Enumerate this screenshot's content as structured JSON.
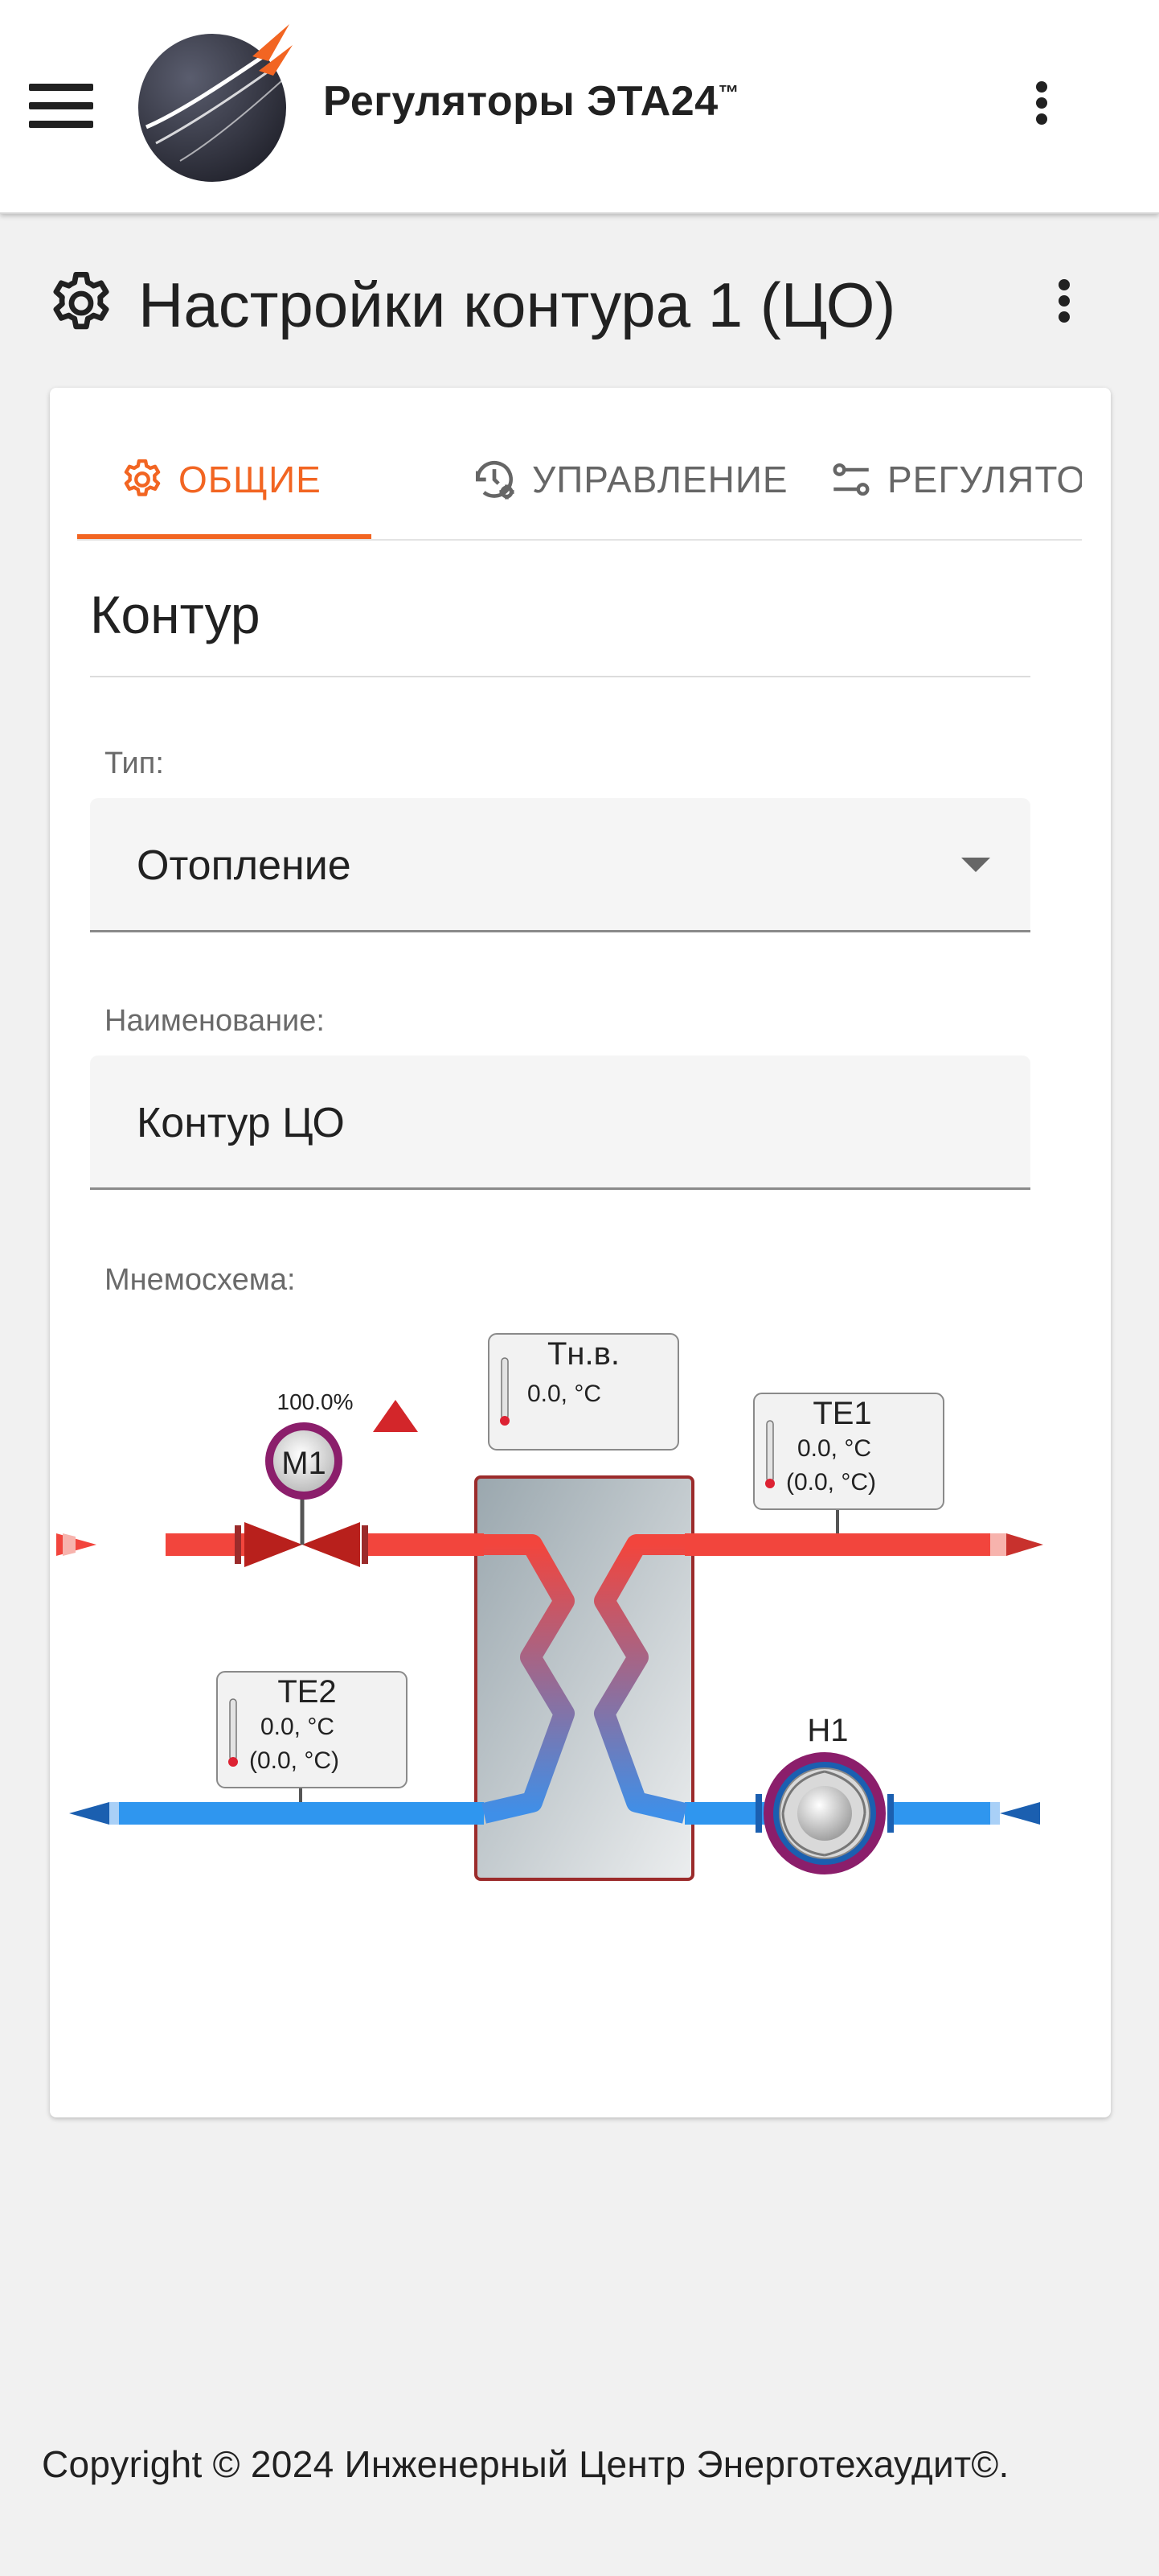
{
  "app": {
    "title": "Регуляторы ЭТА24",
    "trademark": "™"
  },
  "page": {
    "title": "Настройки контура 1 (ЦО)"
  },
  "tabs": [
    {
      "label": "ОБЩИЕ",
      "icon": "gear-icon",
      "active": true
    },
    {
      "label": "УПРАВЛЕНИЕ",
      "icon": "history-settings-icon",
      "active": false
    },
    {
      "label": "РЕГУЛЯТО",
      "icon": "sliders-icon",
      "active": false
    }
  ],
  "section": {
    "title": "Контур"
  },
  "fields": {
    "type": {
      "label": "Тип:",
      "value": "Отопление"
    },
    "name": {
      "label": "Наименование:",
      "value": "Контур ЦО"
    },
    "scheme": {
      "label": "Мнемосхема:"
    }
  },
  "diagram": {
    "valve": {
      "label": "M1",
      "percent": "100.0%"
    },
    "outdoor_sensor": {
      "label": "Тн.в.",
      "value": "0.0, °C"
    },
    "te1": {
      "label": "TE1",
      "value": "0.0, °C",
      "setpoint": "(0.0, °C)"
    },
    "te2": {
      "label": "TE2",
      "value": "0.0, °C",
      "setpoint": "(0.0, °C)"
    },
    "pump": {
      "label": "H1"
    }
  },
  "colors": {
    "accent": "#f26522",
    "hot_pipe": "#f2453d",
    "cold_pipe": "#2f96ef",
    "device_ring": "#8b1e6b"
  },
  "footer": {
    "copyright": "Copyright © 2024 Инженерный Центр Энерготехаудит©."
  }
}
